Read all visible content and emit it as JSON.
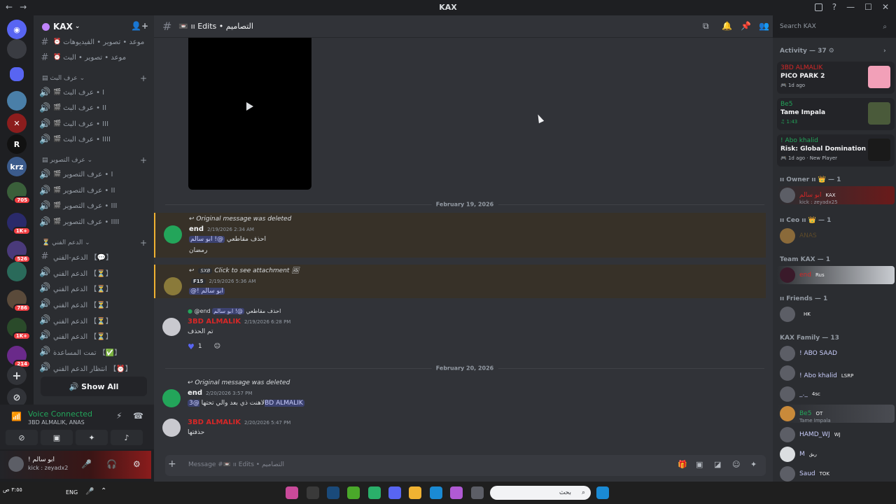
{
  "window": {
    "title": "KAX",
    "nav_back": "←",
    "nav_forward": "→",
    "controls": [
      "—",
      "☐",
      "✕"
    ]
  },
  "servers": {
    "badges": [
      "705",
      "1K+",
      "526",
      "786",
      "1K+",
      "214"
    ],
    "labels": [
      "R",
      "krz"
    ]
  },
  "guild": {
    "name": "KAX"
  },
  "channels": {
    "items": [
      {
        "label": "موعد • تصوير • الفيديوهات",
        "emoji": "⏰",
        "icon": "#"
      },
      {
        "label": "موعد • تصوير • البث",
        "emoji": "⏰",
        "icon": "#"
      }
    ],
    "categories": [
      {
        "name": "عرف البث",
        "channels": [
          "عرف البث • I",
          "عرف البث • II",
          "عرف البث • III",
          "عرف البث • IIII"
        ]
      },
      {
        "name": "عرف التصوير",
        "channels": [
          "عرف التصوير • I",
          "عرف التصوير • II",
          "عرف التصوير • III",
          "عرف التصوير • IIII"
        ]
      },
      {
        "name": "الدعم الفني",
        "channels": [
          "الدعم-الفني 【💬】",
          "الدعم الفني 【⏳】",
          "الدعم الفني 【⏳】",
          "الدعم الفني 【⏳】",
          "الدعم الفني 【⏳】",
          "الدعم الفني 【⏳】",
          "تمت المساعدة 【✅】",
          "انتظار الدعم الفني 【⏰】"
        ]
      }
    ],
    "show_all": "Show All"
  },
  "voice": {
    "status": "Voice Connected",
    "members": "3BD ALMALIK, ANAS"
  },
  "user": {
    "name": "! ابو سالم",
    "status": "kick : zeyadx2"
  },
  "chat": {
    "channel_name": "📼 ıı Edits • التصاميم",
    "date_1": "February 19, 2026",
    "date_2": "February 20, 2026",
    "messages": [
      {
        "reply": "Original message was deleted",
        "author": "end",
        "time": "2/19/2026 2:34 AM",
        "text_mention": "@! ابو سالم",
        "text": "احذف مقاطعي",
        "text2": "رمضان"
      },
      {
        "reply_suffix": "Click to see attachment",
        "reply_tag": "SXB",
        "author_tag": "F15",
        "time": "2/19/2026 5:36 AM",
        "text_mention": "@! ابو سالم"
      },
      {
        "reply_author": "@end",
        "reply_text": "احذف مقاطعي",
        "reply_mention": "@! ابو سالم",
        "author": "3BD ALMALIK",
        "time": "2/19/2026 6:28 PM",
        "text": "تم الحذف",
        "reaction_count": "1"
      },
      {
        "reply": "Original message was deleted",
        "author": "end",
        "time": "2/20/2026 3:57 PM",
        "text": "لاهنت ذي بعد والي تحتها",
        "text_mention": "@3BD ALMALIK"
      },
      {
        "author": "3BD ALMALIK",
        "time": "2/20/2026 5:47 PM",
        "text": "حذفتها"
      }
    ],
    "input_placeholder": "Message #📼 ıı Edits • التصاميم"
  },
  "search": {
    "placeholder": "Search KAX"
  },
  "members": {
    "activity_header": "Activity — 37",
    "activities": [
      {
        "name": "3BD ALMALIK",
        "title": "PICO PARK 2",
        "sub": "1d ago",
        "color": "#d62727"
      },
      {
        "name": "Be5",
        "title": "Tame Impala",
        "sub": "1:43",
        "color": "#23a55a"
      },
      {
        "name": "! Abo khalid",
        "title": "Risk: Global Domination",
        "sub": "1d ago  ·  New Player",
        "color": "#23a55a"
      }
    ],
    "groups": [
      {
        "header": "ıı Owner ıı 👑 — 1",
        "members": [
          {
            "name": "ابو سالم",
            "tag": "KAX",
            "sub": "kick : zeyadx25"
          }
        ]
      },
      {
        "header": "ıı Ceo ıı 👑 — 1",
        "members": [
          {
            "name": "ANAS"
          }
        ]
      },
      {
        "header": "Team KAX — 1",
        "members": [
          {
            "name": "end",
            "tag": "Rus"
          }
        ]
      },
      {
        "header": "ıı Friends — 1",
        "members": [
          {
            "name": "",
            "tag": "HK"
          }
        ]
      },
      {
        "header": "KAX Family — 13",
        "members": [
          {
            "name": "! ABO SAAD"
          },
          {
            "name": "! Abo khalid",
            "tag": "LSRP"
          },
          {
            "name": "_._",
            "tag": "4sc"
          },
          {
            "name": "Be5",
            "tag": "OT",
            "sub": "Tame Impala"
          },
          {
            "name": "HAMD_WJ",
            "tag": "WJ"
          },
          {
            "name": "M",
            "tag": "ريق"
          },
          {
            "name": "Saud",
            "tag": "TOK"
          }
        ]
      }
    ]
  },
  "taskbar": {
    "clock": "٣:٥٥ ص",
    "lang": "ENG",
    "search": "بحث"
  }
}
